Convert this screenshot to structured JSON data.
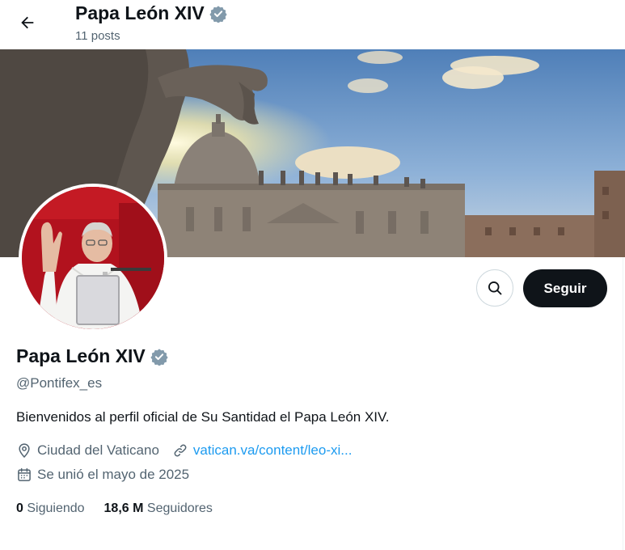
{
  "header": {
    "back_icon": "arrow-left-icon",
    "title": "Papa León XIV",
    "posts_count": "11 posts"
  },
  "banner": {
    "image": "st-peters-basilica-banner"
  },
  "avatar": {
    "image": "pope-waving-avatar"
  },
  "actions": {
    "search_icon": "search-icon",
    "follow_label": "Seguir"
  },
  "profile": {
    "name": "Papa León XIV",
    "verified_icon": "verified-badge-icon",
    "handle": "@Pontifex_es",
    "bio": "Bienvenidos al perfil oficial de Su Santidad el Papa León XIV.",
    "location": "Ciudad del Vaticano",
    "website": "vatican.va/content/leo-xi...",
    "joined": "Se unió el mayo de 2025"
  },
  "stats": {
    "following_count": "0",
    "following_label": "Siguiendo",
    "followers_count": "18,6 M",
    "followers_label": "Seguidores"
  },
  "colors": {
    "text": "#0f1419",
    "secondary": "#536471",
    "link": "#1d9bf0",
    "verified": "#829aab",
    "follow_bg": "#0f1419",
    "avatar_bg": "#b2121e"
  }
}
